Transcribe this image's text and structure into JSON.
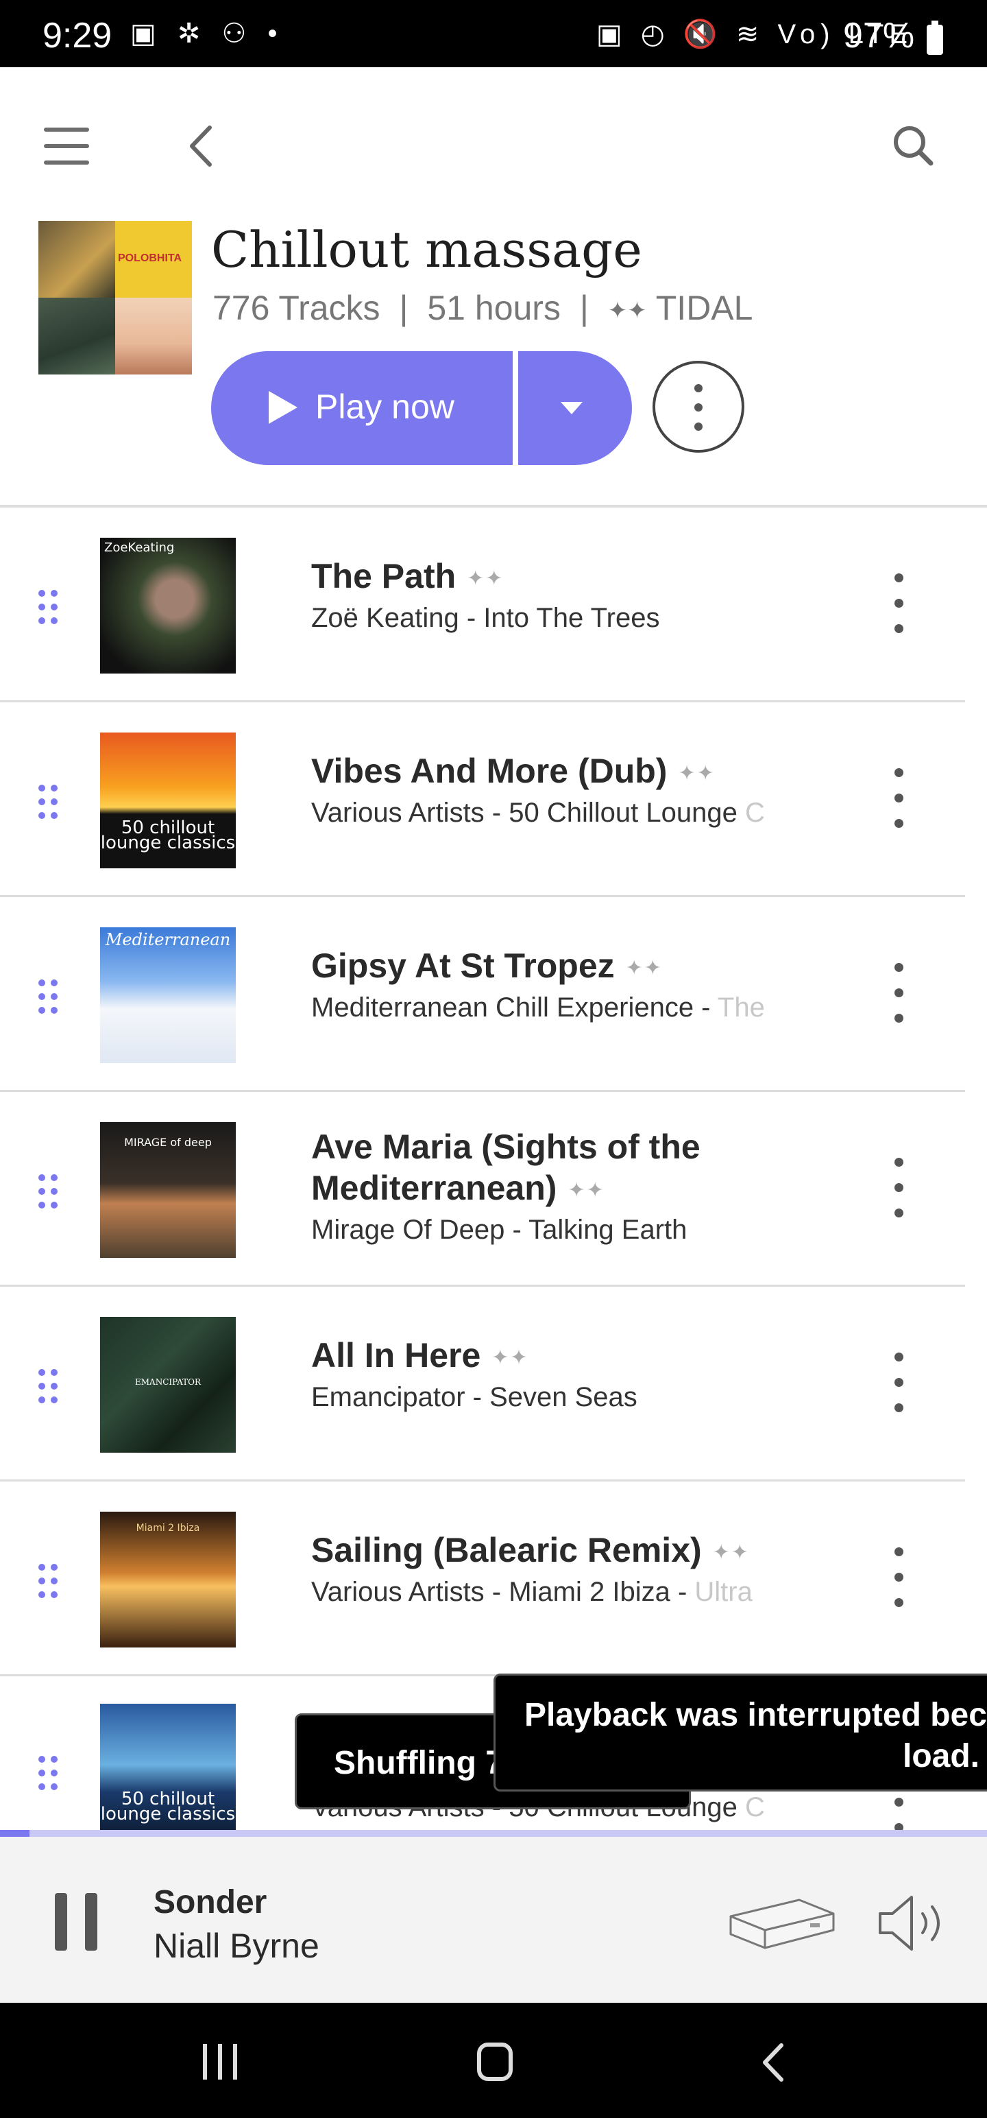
{
  "status_bar": {
    "time": "9:29",
    "left_icons": "▣ ✲ ⚇ •",
    "right_icons": "▣ ◴ 🔇 ≋ Vo) LTE ▮",
    "battery": "97%"
  },
  "top_bar": {
    "menu_icon": "hamburger-icon",
    "back_icon": "chevron-left-icon",
    "search_icon": "search-icon"
  },
  "playlist": {
    "title": "Chillout massage",
    "tracks_count": "776 Tracks",
    "duration": "51 hours",
    "source": "TIDAL",
    "separator": "|",
    "play_label": "Play now",
    "cover_art_text": [
      "",
      "POLOBHITA",
      "",
      ""
    ]
  },
  "tracks": [
    {
      "title": "The Path",
      "artist_album": "Zoë Keating - Into The Trees",
      "fade": "",
      "art_text": "ZoeKeating"
    },
    {
      "title": "Vibes And More (Dub)",
      "artist_album": "Various Artists - 50 Chillout Lounge ",
      "fade": "C",
      "art_text": "50 chillout lounge classics"
    },
    {
      "title": "Gipsy At St Tropez",
      "artist_album": "Mediterranean Chill Experience - ",
      "fade": "The",
      "art_text": "Mediterranean"
    },
    {
      "title": "Ave Maria (Sights of the Mediterranean)",
      "artist_album": "Mirage Of Deep - Talking Earth",
      "fade": "",
      "art_text": "MIRAGE of deep"
    },
    {
      "title": "All In Here",
      "artist_album": "Emancipator - Seven Seas",
      "fade": "",
      "art_text": "EMANCIPATOR"
    },
    {
      "title": "Sailing (Balearic Remix)",
      "artist_album": "Various Artists - Miami 2 Ibiza - ",
      "fade": "Ultra",
      "art_text": "Miami 2 Ibiza"
    },
    {
      "title": "",
      "artist_album": "Various Artists - 50 Chillout Lounge ",
      "fade": "C",
      "art_text": "50 chillout lounge classics"
    }
  ],
  "toasts": {
    "shuffling": "Shuffling 7",
    "playback_line1": "Playback was interrupted bec",
    "playback_line2": "load."
  },
  "now_playing": {
    "title": "Sonder",
    "artist": "Niall Byrne",
    "progress": 0.03
  },
  "colors": {
    "accent": "#7b77ee",
    "accent_light": "#c9c7f6"
  }
}
